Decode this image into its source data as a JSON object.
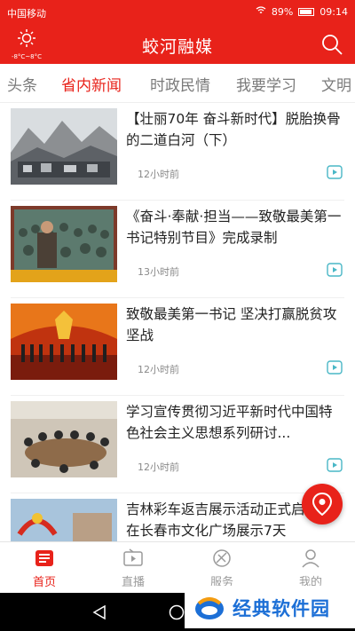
{
  "status_bar": {
    "carrier": "中国移动",
    "battery": "89%",
    "time": "09:14"
  },
  "header": {
    "title": "蛟河融媒",
    "weather_temp": "-8°C~8°C",
    "search_icon": "search-icon"
  },
  "tabs": [
    {
      "label": "头条",
      "active": false
    },
    {
      "label": "省内新闻",
      "active": true
    },
    {
      "label": "时政民情",
      "active": false
    },
    {
      "label": "我要学习",
      "active": false
    },
    {
      "label": "文明",
      "active": false
    }
  ],
  "news": [
    {
      "headline": "【壮丽70年 奋斗新时代】脱胎换骨的二道白河（下）",
      "time": "12小时前",
      "thumb": "mountain-town-photo"
    },
    {
      "headline": "《奋斗·奉献·担当——致敬最美第一书记特别节目》完成录制",
      "time": "13小时前",
      "thumb": "crowd-stage-photo"
    },
    {
      "headline": "致敬最美第一书记 坚决打赢脱贫攻坚战",
      "time": "12小时前",
      "thumb": "stage-ceremony-photo"
    },
    {
      "headline": "学习宣传贯彻习近平新时代中国特色社会主义思想系列研讨...",
      "time": "12小时前",
      "thumb": "meeting-room-photo"
    },
    {
      "headline": "吉林彩车返吉展示活动正式启动 将在长春市文化广场展示7天",
      "time": "",
      "thumb": "parade-float-photo"
    }
  ],
  "bottom_nav": [
    {
      "label": "首页",
      "active": true,
      "icon": "home-news-icon"
    },
    {
      "label": "直播",
      "active": false,
      "icon": "live-tv-icon"
    },
    {
      "label": "服务",
      "active": false,
      "icon": "service-icon"
    },
    {
      "label": "我的",
      "active": false,
      "icon": "profile-icon"
    }
  ],
  "watermark": {
    "text": "经典软件园"
  },
  "colors": {
    "accent": "#e8221a",
    "watermark_blue": "#1c6fd6"
  }
}
